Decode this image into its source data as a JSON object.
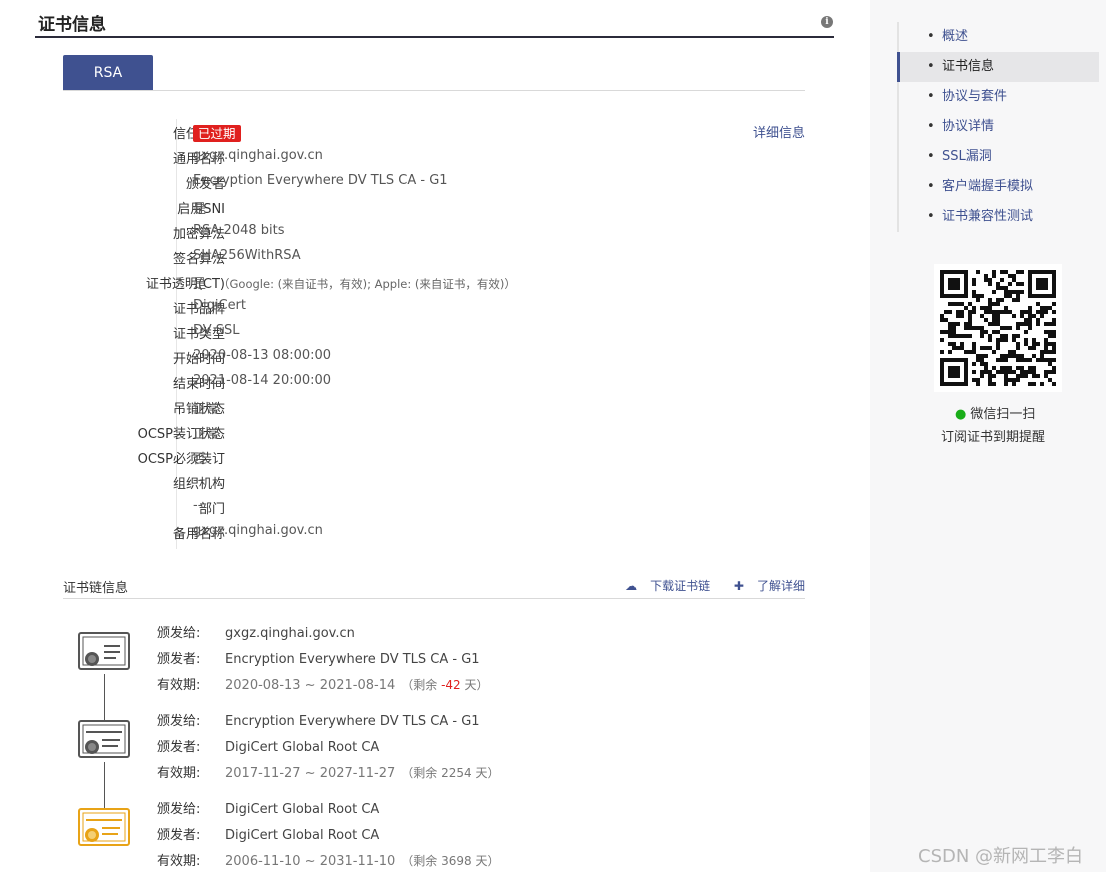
{
  "section": {
    "title": "证书信息"
  },
  "tabs": [
    {
      "label": "RSA"
    }
  ],
  "detail_link": "详细信息",
  "fields": [
    {
      "label": "信任状态",
      "value": "已过期",
      "badge": true
    },
    {
      "label": "通用名称",
      "value": "gxgz.qinghai.gov.cn"
    },
    {
      "label": "颁发者",
      "value": "Encryption Everywhere DV TLS CA - G1"
    },
    {
      "label": "启用SNI",
      "value": "是"
    },
    {
      "label": "加密算法",
      "value": "RSA 2048 bits"
    },
    {
      "label": "签名算法",
      "value": "SHA256WithRSA"
    },
    {
      "label": "证书透明(CT)",
      "value": "是",
      "extra": "（Google: (来自证书，有效); Apple: (来自证书，有效)）"
    },
    {
      "label": "证书品牌",
      "value": "DigiCert"
    },
    {
      "label": "证书类型",
      "value": "DV SSL"
    },
    {
      "label": "开始时间",
      "value": "2020-08-13 08:00:00"
    },
    {
      "label": "结束时间",
      "value": "2021-08-14 20:00:00"
    },
    {
      "label": "吊销状态",
      "value": "正常"
    },
    {
      "label": "OCSP装订状态",
      "value": "正常"
    },
    {
      "label": "OCSP必须装订",
      "value": "否"
    },
    {
      "label": "组织机构",
      "value": "--"
    },
    {
      "label": "部门",
      "value": "--"
    },
    {
      "label": "备用名称",
      "value": "gxgz.qinghai.gov.cn"
    }
  ],
  "chain": {
    "title": "证书链信息",
    "download_label": "下载证书链",
    "learn_label": "了解详细",
    "labels": {
      "issued_to": "颁发给:",
      "issuer": "颁发者:",
      "validity": "有效期:"
    },
    "certs": [
      {
        "issued_to": "gxgz.qinghai.gov.cn",
        "issuer": "Encryption Everywhere DV TLS CA - G1",
        "validity": "2020-08-13 ~ 2021-08-14",
        "remain_prefix": "（剩余 ",
        "remain": "-42",
        "remain_suffix": " 天）",
        "negative": true
      },
      {
        "issued_to": "Encryption Everywhere DV TLS CA - G1",
        "issuer": "DigiCert Global Root CA",
        "validity": "2017-11-27 ~ 2027-11-27",
        "remain_prefix": "（剩余 ",
        "remain": "2254",
        "remain_suffix": " 天）",
        "negative": false
      },
      {
        "issued_to": "DigiCert Global Root CA",
        "issuer": "DigiCert Global Root CA",
        "validity": "2006-11-10 ~ 2031-11-10",
        "remain_prefix": "（剩余 ",
        "remain": "3698",
        "remain_suffix": " 天）",
        "negative": false
      }
    ]
  },
  "toc": [
    {
      "label": "概述",
      "active": false
    },
    {
      "label": "证书信息",
      "active": true
    },
    {
      "label": "协议与套件",
      "active": false
    },
    {
      "label": "协议详情",
      "active": false
    },
    {
      "label": "SSL漏洞",
      "active": false
    },
    {
      "label": "客户端握手模拟",
      "active": false
    },
    {
      "label": "证书兼容性测试",
      "active": false
    }
  ],
  "wechat": {
    "scan": "微信扫一扫",
    "subscribe": "订阅证书到期提醒"
  },
  "watermark": "CSDN @新网工李白",
  "colors": {
    "accent": "#3f5190",
    "expired": "#e0201e",
    "wechat": "#1aad19",
    "root_cert": "#e8a317"
  }
}
